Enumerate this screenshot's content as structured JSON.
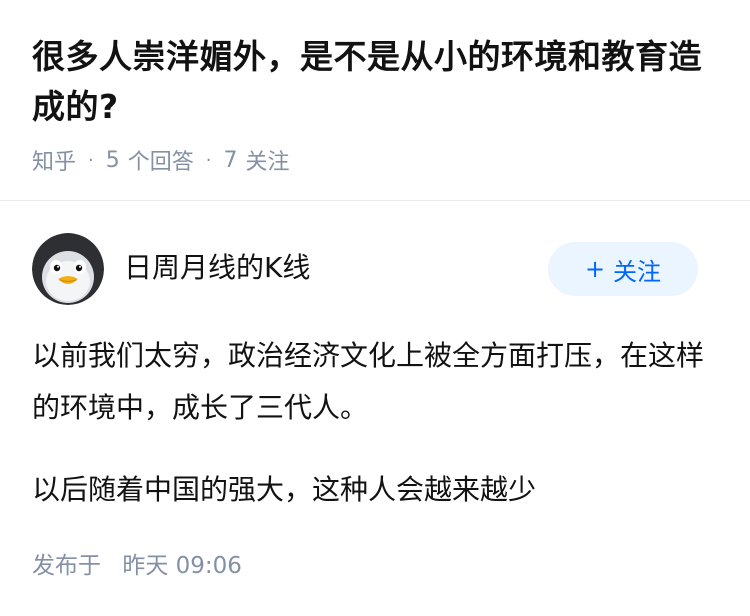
{
  "question": {
    "title": "很多人崇洋媚外，是不是从小的环境和教育造成的?"
  },
  "meta": {
    "source": "知乎",
    "answers_count": "5",
    "answers_label": "个回答",
    "followers_count": "7",
    "followers_label": "关注"
  },
  "author": {
    "name": "日周月线的K线",
    "avatar_icon": "penguin-avatar-icon",
    "follow_plus": "+",
    "follow_label": "关注"
  },
  "answer": {
    "paragraphs": [
      "以前我们太穷，政治经济文化上被全方面打压，在这样的环境中，成长了三代人。",
      "以后随着中国的强大，这种人会越来越少"
    ]
  },
  "published": {
    "label": "发布于",
    "time": "昨天 09:06"
  },
  "colors": {
    "accent": "#0066ff",
    "follow_bg": "#ebf5ff",
    "meta_gray": "#8590a6"
  }
}
